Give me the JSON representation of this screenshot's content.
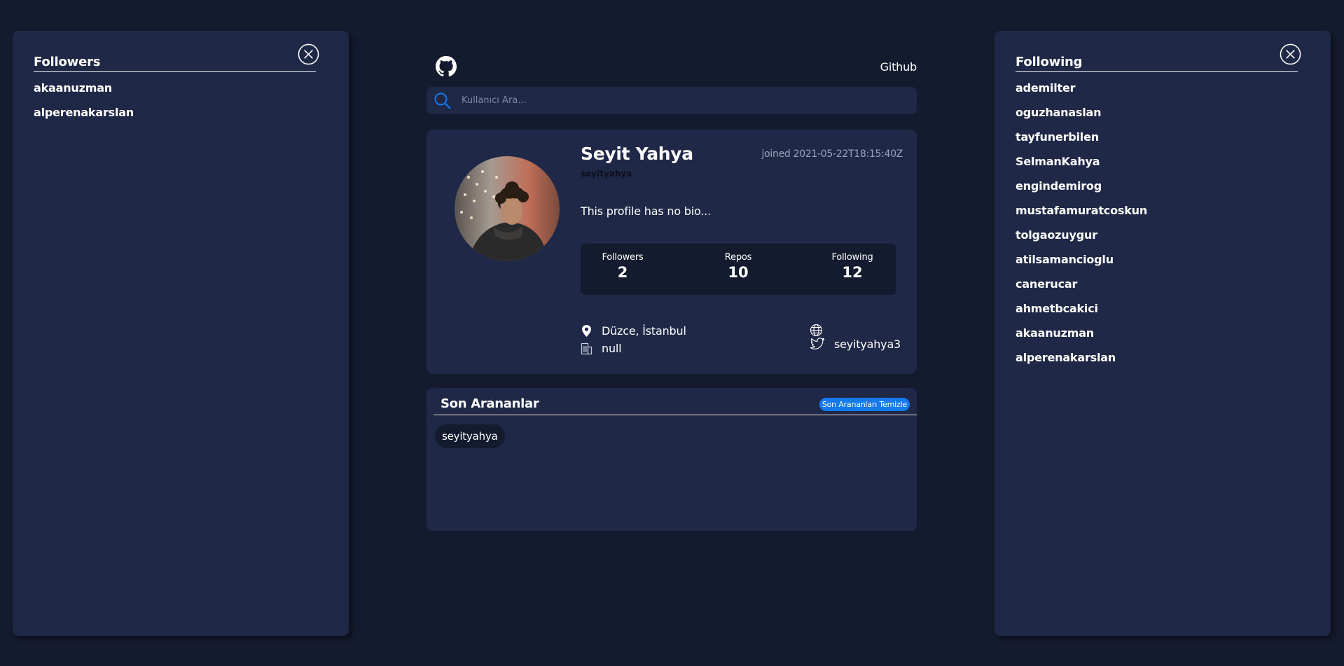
{
  "followers_panel": {
    "title": "Followers",
    "items": [
      "akaanuzman",
      "alperenakarslan"
    ]
  },
  "following_panel": {
    "title": "Following",
    "items": [
      "ademilter",
      "oguzhanaslan",
      "tayfunerbilen",
      "SelmanKahya",
      "engindemirog",
      "mustafamuratcoskun",
      "tolgaozuygur",
      "atilsamancioglu",
      "canerucar",
      "ahmetbcakici",
      "akaanuzman",
      "alperenakarslan"
    ]
  },
  "header": {
    "link_label": "Github"
  },
  "search": {
    "placeholder": "Kullanıcı Ara..."
  },
  "profile": {
    "name": "Seyit Yahya",
    "login": "seyityahya",
    "joined": "joined 2021-05-22T18:15:40Z",
    "bio": "This profile has no bio...",
    "stats": [
      {
        "label": "Followers",
        "value": "2"
      },
      {
        "label": "Repos",
        "value": "10"
      },
      {
        "label": "Following",
        "value": "12"
      }
    ],
    "location": "Düzce, İstanbul",
    "company": "null",
    "twitter": "seyityahya3"
  },
  "recent": {
    "title": "Son Arananlar",
    "clear_label": "Son Arananları Temizle",
    "items": [
      "seyityahya"
    ]
  },
  "colors": {
    "background": "#141b2e",
    "panel": "#1f2847",
    "accent": "#1479ef"
  },
  "icons": [
    "close-icon",
    "github-icon",
    "search-icon",
    "location-icon",
    "building-icon",
    "globe-icon",
    "twitter-icon"
  ]
}
